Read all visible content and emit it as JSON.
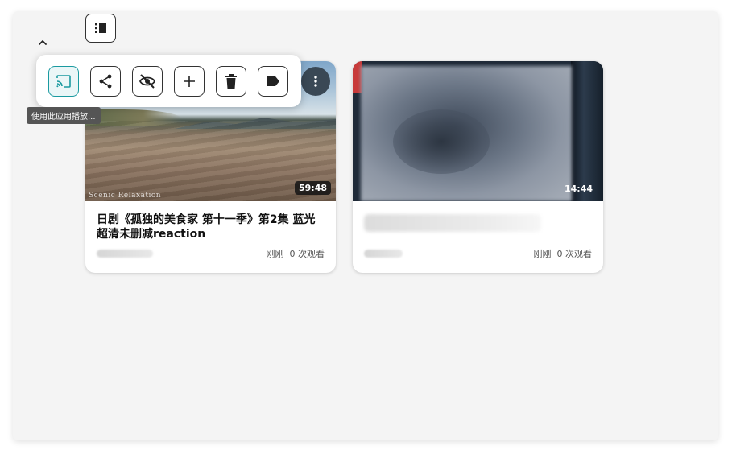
{
  "toolbar": {
    "collapse_icon": "chevron-up-icon",
    "queue_icon": "playlist-icon"
  },
  "popup": {
    "actions": [
      {
        "name": "cast",
        "icon": "cast-icon",
        "active": true
      },
      {
        "name": "share",
        "icon": "share-icon"
      },
      {
        "name": "hide",
        "icon": "eye-off-icon"
      },
      {
        "name": "add",
        "icon": "plus-icon"
      },
      {
        "name": "delete",
        "icon": "trash-icon"
      },
      {
        "name": "tag",
        "icon": "label-icon"
      }
    ],
    "tooltip": "使用此应用播放..."
  },
  "videos": [
    {
      "title": "日剧《孤独的美食家 第十一季》第2集 蓝光超清未删减reaction",
      "duration": "59:48",
      "watermark": "Scenic Relaxation",
      "time_ago": "刚刚",
      "views": "0 次观看"
    },
    {
      "title": "",
      "duration": "14:44",
      "time_ago": "刚刚",
      "views": "0 次观看"
    }
  ],
  "colors": {
    "accent": "#1a9aa0",
    "panel_bg": "#f4f4f4",
    "more_button": "#3a4855"
  }
}
